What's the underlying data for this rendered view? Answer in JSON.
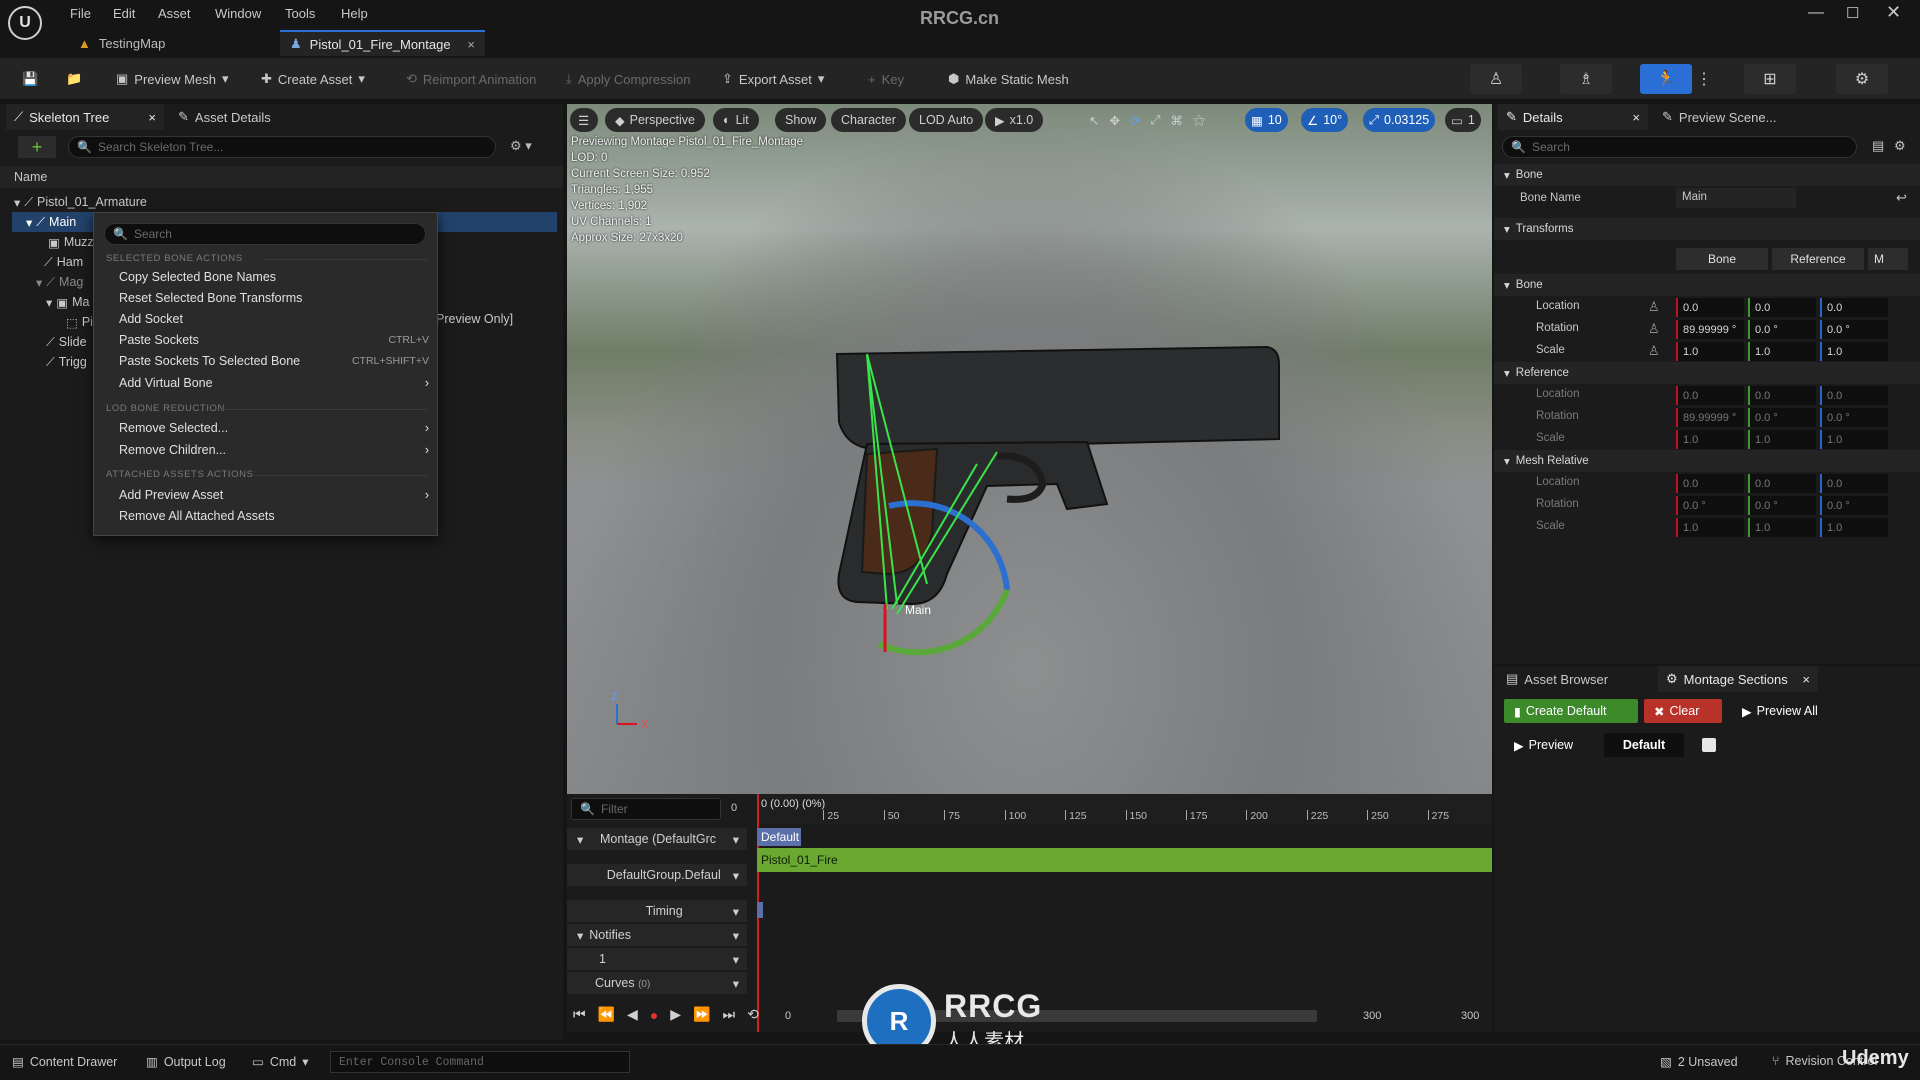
{
  "title_bar": {
    "watermark": "RRCG.cn",
    "menu": [
      "File",
      "Edit",
      "Asset",
      "Window",
      "Tools",
      "Help"
    ],
    "tabs": [
      {
        "label": "TestingMap",
        "icon": "level-icon"
      },
      {
        "label": "Pistol_01_Fire_Montage",
        "icon": "montage-icon"
      }
    ]
  },
  "toolbar": {
    "preview_mesh": "Preview Mesh",
    "create_asset": "Create Asset",
    "reimport": "Reimport Animation",
    "apply_compression": "Apply Compression",
    "export_asset": "Export Asset",
    "key": "Key",
    "make_static_mesh": "Make Static Mesh"
  },
  "skeleton_panel": {
    "tab_skeleton": "Skeleton Tree",
    "tab_details": "Asset Details",
    "search_placeholder": "Search Skeleton Tree...",
    "column_name": "Name",
    "tree": [
      "Pistol_01_Armature",
      "Main",
      "Muzz",
      "Ham",
      "Mag",
      "Ma",
      "Pi",
      "Slide",
      "Trigg"
    ],
    "preview_only": "Preview Only]"
  },
  "context_menu": {
    "search_placeholder": "Search",
    "sec_selected": "SELECTED BONE ACTIONS",
    "copy_names": "Copy Selected Bone Names",
    "reset_transforms": "Reset Selected Bone Transforms",
    "add_socket": "Add Socket",
    "paste_sockets": "Paste Sockets",
    "paste_sockets_sc": "CTRL+V",
    "paste_to_bone": "Paste Sockets To Selected Bone",
    "paste_to_bone_sc": "CTRL+SHIFT+V",
    "add_virtual": "Add Virtual Bone",
    "sec_lod": "LOD BONE REDUCTION",
    "remove_selected": "Remove Selected...",
    "remove_children": "Remove Children...",
    "sec_attached": "ATTACHED ASSETS ACTIONS",
    "add_preview": "Add Preview Asset",
    "remove_attached": "Remove All Attached Assets"
  },
  "viewport": {
    "toolbar": [
      "Perspective",
      "Lit",
      "Show",
      "Character",
      "LOD Auto",
      "x1.0"
    ],
    "grid_snap": "10",
    "rot_snap": "10°",
    "scale_snap": "0.03125",
    "cam_speed": "1",
    "stats": [
      "Previewing Montage Pistol_01_Fire_Montage",
      "LOD: 0",
      "Current Screen Size: 0.952",
      "Triangles: 1,955",
      "Vertices: 1,902",
      "UV Channels: 1",
      "Approx Size: 27x3x20"
    ],
    "bone_label": "Main",
    "axis_z": "Z",
    "axis_x": "X"
  },
  "timeline": {
    "filter_placeholder": "Filter",
    "filter_count": "0",
    "position": "0 (0.00) (0%)",
    "ticks": [
      "25",
      "50",
      "75",
      "100",
      "125",
      "150",
      "175",
      "200",
      "225",
      "250",
      "275"
    ],
    "rows": {
      "montage": "Montage (DefaultGrc",
      "group": "DefaultGroup.Defaul",
      "timing": "Timing",
      "notifies": "Notifies",
      "notify_track": "1",
      "curves": "Curves",
      "curves_count": "(0)"
    },
    "section_label": "Default",
    "segment_label": "Pistol_01_Fire",
    "transport": {
      "start": "0",
      "end": "300",
      "end2": "300"
    }
  },
  "details": {
    "tab_details": "Details",
    "tab_preview": "Preview Scene...",
    "search_placeholder": "Search",
    "section_bone": "Bone",
    "bone_name_label": "Bone Name",
    "bone_name_value": "Main",
    "section_transforms": "Transforms",
    "seg_bone": "Bone",
    "seg_reference": "Reference",
    "seg_m": "M",
    "groups": [
      {
        "name": "Bone",
        "dim": false,
        "rows": [
          {
            "label": "Location",
            "x": "0.0",
            "y": "0.0",
            "z": "0.0"
          },
          {
            "label": "Rotation",
            "x": "89.99999 °",
            "y": "0.0 °",
            "z": "0.0 °"
          },
          {
            "label": "Scale",
            "x": "1.0",
            "y": "1.0",
            "z": "1.0"
          }
        ]
      },
      {
        "name": "Reference",
        "dim": true,
        "rows": [
          {
            "label": "Location",
            "x": "0.0",
            "y": "0.0",
            "z": "0.0"
          },
          {
            "label": "Rotation",
            "x": "89.99999 °",
            "y": "0.0 °",
            "z": "0.0 °"
          },
          {
            "label": "Scale",
            "x": "1.0",
            "y": "1.0",
            "z": "1.0"
          }
        ]
      },
      {
        "name": "Mesh Relative",
        "dim": true,
        "rows": [
          {
            "label": "Location",
            "x": "0.0",
            "y": "0.0",
            "z": "0.0"
          },
          {
            "label": "Rotation",
            "x": "0.0 °",
            "y": "0.0 °",
            "z": "0.0 °"
          },
          {
            "label": "Scale",
            "x": "1.0",
            "y": "1.0",
            "z": "1.0"
          }
        ]
      }
    ]
  },
  "montage_sections": {
    "tab_asset_browser": "Asset Browser",
    "tab_montage": "Montage Sections",
    "create_default": "Create Default",
    "clear": "Clear",
    "preview_all": "Preview All",
    "preview": "Preview",
    "default": "Default"
  },
  "status_bar": {
    "content_drawer": "Content Drawer",
    "output_log": "Output Log",
    "cmd": "Cmd",
    "console_placeholder": "Enter Console Command",
    "unsaved": "2 Unsaved",
    "revision": "Revision Control",
    "brand": "Udemy"
  },
  "logo_text": {
    "top": "RRCG",
    "bottom": "人人素材"
  },
  "colors": {
    "accent": "#2a6fd6",
    "green": "#6aa832",
    "red": "#b8322a",
    "create_default": "#3c8a2a"
  }
}
